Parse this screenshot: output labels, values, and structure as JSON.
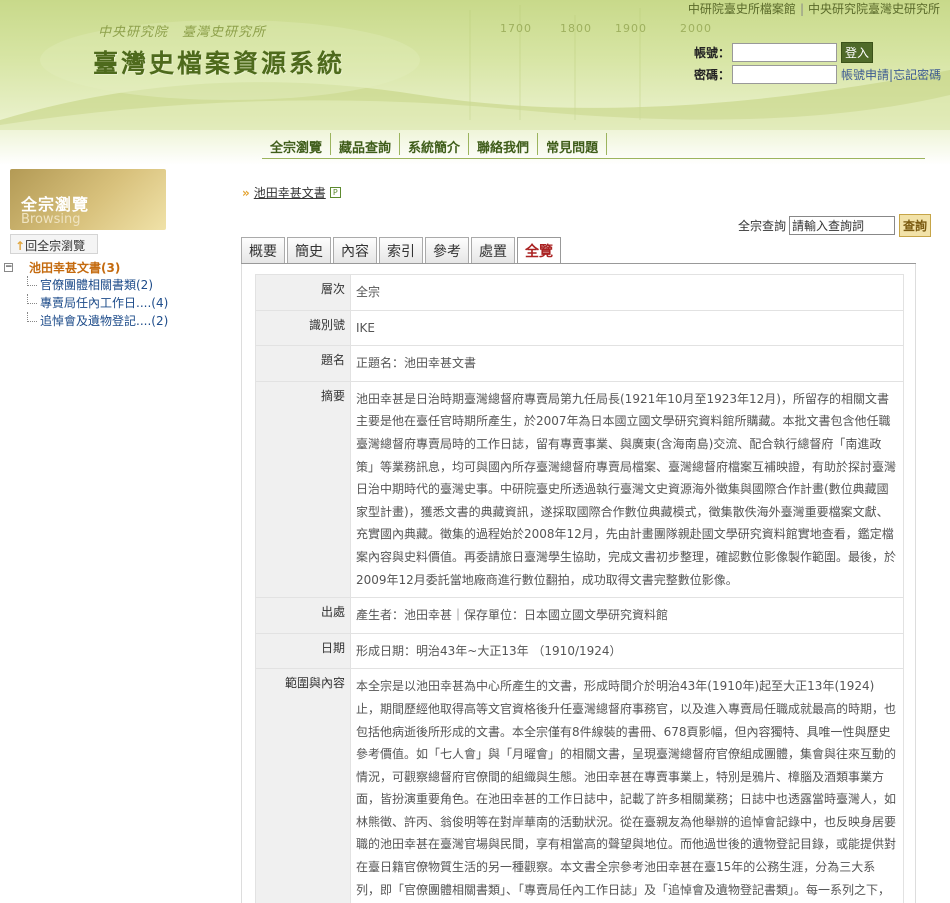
{
  "header": {
    "org_line": "中央研究院　臺灣史研究所",
    "site_title": "臺灣史檔案資源系統",
    "years": [
      "1700",
      "1800",
      "1900",
      "2000"
    ],
    "top_links": [
      "中研院臺史所檔案館",
      "中央研究院臺灣史研究所"
    ],
    "login": {
      "account_label": "帳號：",
      "password_label": "密碼：",
      "login_button": "登入",
      "apply_link": "帳號申請",
      "forgot_link": "忘記密碼"
    }
  },
  "nav": [
    "全宗瀏覽",
    "藏品查詢",
    "系統簡介",
    "聯絡我們",
    "常見問題"
  ],
  "sidebar": {
    "badge_title": "全宗瀏覽",
    "badge_sub": "Browsing",
    "back_label": "回全宗瀏覽",
    "tree_root": "池田幸甚文書(3)",
    "tree_children": [
      "官僚團體相關書類(2)",
      "專賣局任內工作日....(4)",
      "追悼會及遺物登記....(2)"
    ]
  },
  "breadcrumb": {
    "link": "池田幸甚文書"
  },
  "search": {
    "label": "全宗查詢",
    "placeholder": "請輸入查詢詞",
    "button": "查詢"
  },
  "tabs": [
    "概要",
    "簡史",
    "內容",
    "索引",
    "參考",
    "處置",
    "全覽"
  ],
  "details": [
    {
      "key": "層次",
      "value": "全宗"
    },
    {
      "key": "識別號",
      "value": "IKE"
    },
    {
      "key": "題名",
      "value": "正題名：池田幸甚文書"
    },
    {
      "key": "摘要",
      "value": "池田幸甚是日治時期臺灣總督府專賣局第九任局長(1921年10月至1923年12月)，所留存的相關文書主要是他在臺任官時期所產生，於2007年為日本國立國文學研究資料館所購藏。本批文書包含他任職臺灣總督府專賣局時的工作日誌，留有專賣事業、與廣東(含海南島)交流、配合執行總督府「南進政策」等業務訊息，均可與國內所存臺灣總督府專賣局檔案、臺灣總督府檔案互補映證，有助於探討臺灣日治中期時代的臺灣史事。中研院臺史所透過執行臺灣文史資源海外徵集與國際合作計畫(數位典藏國家型計畫)，獲悉文書的典藏資訊，遂採取國際合作數位典藏模式，徵集散佚海外臺灣重要檔案文獻、充實國內典藏。徵集的過程始於2008年12月，先由計畫團隊親赴國文學研究資料館實地查看，鑑定檔案內容與史料價值。再委請旅日臺灣學生協助，完成文書初步整理，確認數位影像製作範圍。最後，於2009年12月委託當地廠商進行數位翻拍，成功取得文書完整數位影像。"
    },
    {
      "key": "出處",
      "value": "產生者：池田幸甚｜保存單位：日本國立國文學研究資料館"
    },
    {
      "key": "日期",
      "value": "形成日期：明治43年~大正13年 （1910/1924）"
    },
    {
      "key": "範圍與內容",
      "value": "本全宗是以池田幸甚為中心所產生的文書，形成時間介於明治43年(1910年)起至大正13年(1924)止，期間歷經他取得高等文官資格後升任臺灣總督府事務官，以及進入專賣局任職成就最高的時期，也包括他病逝後所形成的文書。本全宗僅有8件線裝的書冊、678頁影幅，但內容獨特、具唯一性與歷史參考價值。如「七人會」與「月曜會」的相關文書，呈現臺灣總督府官僚組成團體，集會與往來互動的情況，可觀察總督府官僚間的組織與生態。池田幸甚在專賣事業上，特別是鴉片、樟腦及酒類事業方面，皆扮演重要角色。在池田幸甚的工作日誌中，記載了許多相關業務；日誌中也透露當時臺灣人，如林熊徵、許丙、翁俊明等在對岸華南的活動狀況。從在臺親友為他舉辦的追悼會記錄中，也反映身居要職的池田幸甚在臺灣官場與民間，享有相當高的聲望與地位。而他過世後的遺物登記目錄，或能提供對在臺日籍官僚物質生活的另一種觀察。本文書全宗參考池田幸甚在臺15年的公務生涯，分為三大系列，即「官僚團體相關書類」、「專賣局任內工作日誌」及「追悼會及遺物登記書類」。每一系列之下，再依原有實體卷冊分件。"
    }
  ]
}
